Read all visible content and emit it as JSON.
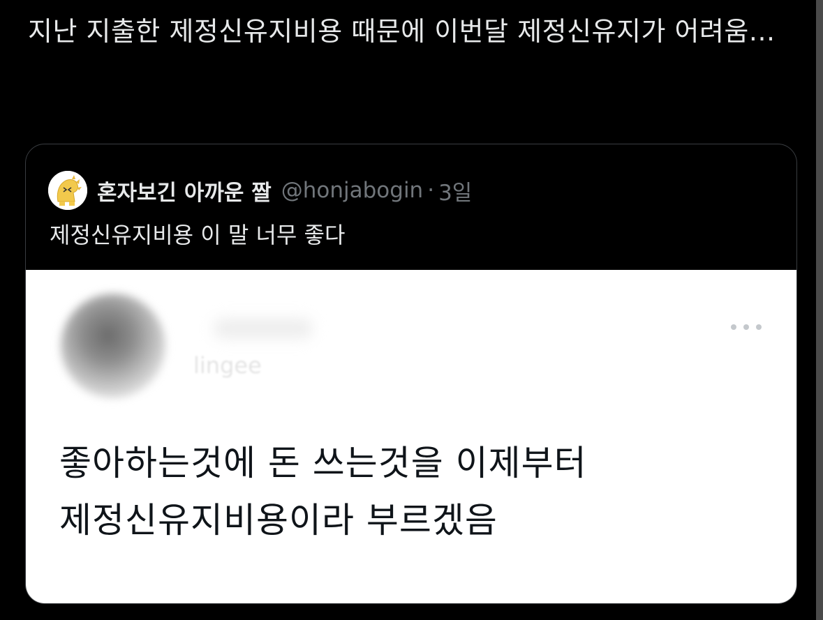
{
  "tweet": {
    "text": "지난 지출한 제정신유지비용 때문에 이번달 제정신유지가 어려움..."
  },
  "quote": {
    "display_name": "혼자보긴 아까운 짤",
    "handle": "@honjabogin",
    "separator": "·",
    "time": "3일",
    "text": "제정신유지비용 이 말 너무 좋다",
    "avatar_icon": "yellow-dinosaur-avatar"
  },
  "media": {
    "blurred_handle": "lingee",
    "more_icon": "more-horizontal-icon",
    "text": "좋아하는것에 돈 쓰는것을 이제부터 제정신유지비용이라 부르겠음"
  },
  "colors": {
    "background": "#000000",
    "primary_text": "#e7e9ea",
    "secondary_text": "#71767b",
    "card_border": "#3a3d41",
    "media_background": "#ffffff",
    "media_text": "#0f1419"
  }
}
